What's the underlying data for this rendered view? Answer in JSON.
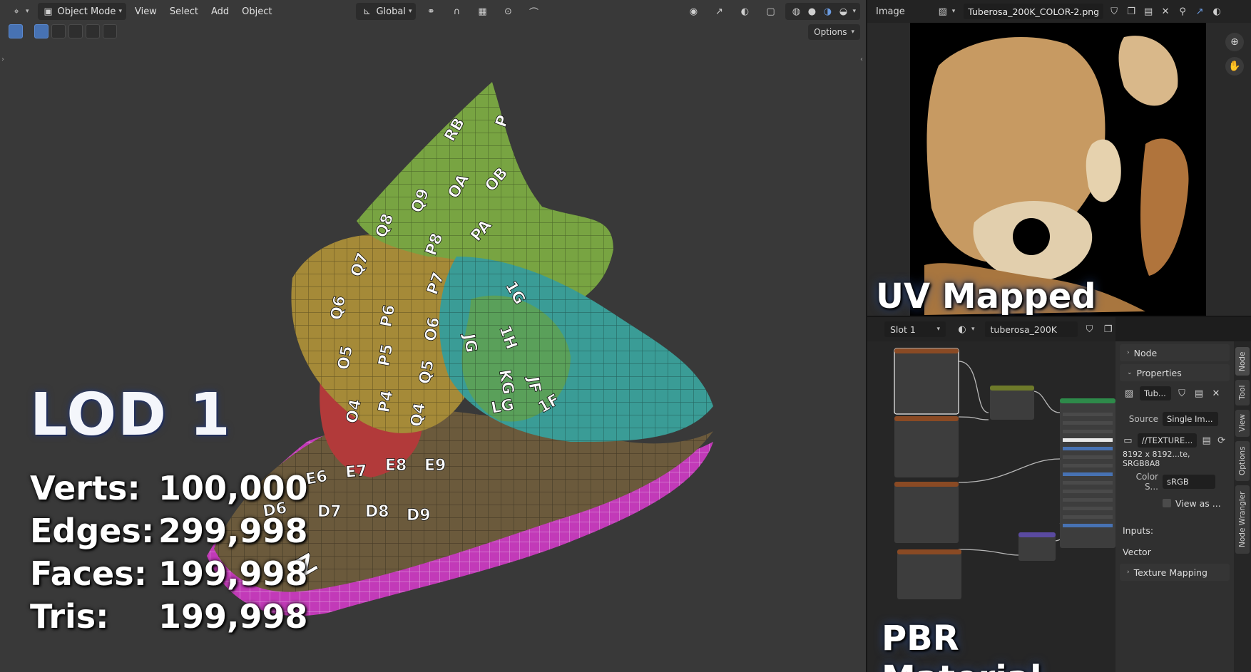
{
  "viewport": {
    "mode": "Object Mode",
    "menu": [
      "View",
      "Select",
      "Add",
      "Object"
    ],
    "orientation": "Global",
    "options_label": "Options",
    "uv_labels": [
      "RB",
      "P",
      "Q8",
      "Q9",
      "OA",
      "OB",
      "PA",
      "Q7",
      "P8",
      "Q6",
      "P7",
      "P6",
      "O6",
      "O5",
      "P5",
      "Q5",
      "O4",
      "P4",
      "Q4",
      "1G",
      "1H",
      "JG",
      "KG",
      "JF",
      "LG",
      "1F",
      "E6",
      "E7",
      "E8",
      "E9",
      "D6",
      "D7",
      "D8",
      "D9",
      "Z"
    ],
    "overlay_title": "LOD 1",
    "stats": [
      {
        "label": "Verts:",
        "value": "100,000"
      },
      {
        "label": "Edges:",
        "value": "299,998"
      },
      {
        "label": "Faces:",
        "value": "199,998"
      },
      {
        "label": "Tris:",
        "value": "199,998"
      }
    ]
  },
  "image_editor": {
    "menu_label": "Image",
    "filename": "Tuberosa_200K_COLOR-2.png",
    "overlay_label": "UV Mapped"
  },
  "shader_editor": {
    "slot": "Slot 1",
    "material": "tuberosa_200K",
    "overlay_label": "PBR Material"
  },
  "sidebar": {
    "node_section": "Node",
    "properties_section": "Properties",
    "image_name": "Tub...",
    "source_label": "Source",
    "source_value": "Single Im...",
    "filepath": "//TEXTURE...",
    "image_info": "8192 x 8192...te, SRGB8A8",
    "color_space_label": "Color S...",
    "color_space_value": "sRGB",
    "view_as_label": "View as ...",
    "inputs_label": "Inputs:",
    "vector_label": "Vector",
    "texture_mapping_label": "Texture Mapping",
    "tabs": [
      "Node",
      "Tool",
      "View",
      "Options",
      "Node Wrangler"
    ]
  },
  "colors": {
    "accent": "#4772b3",
    "viewport_bg": "#393939",
    "panel_bg": "#262626"
  }
}
